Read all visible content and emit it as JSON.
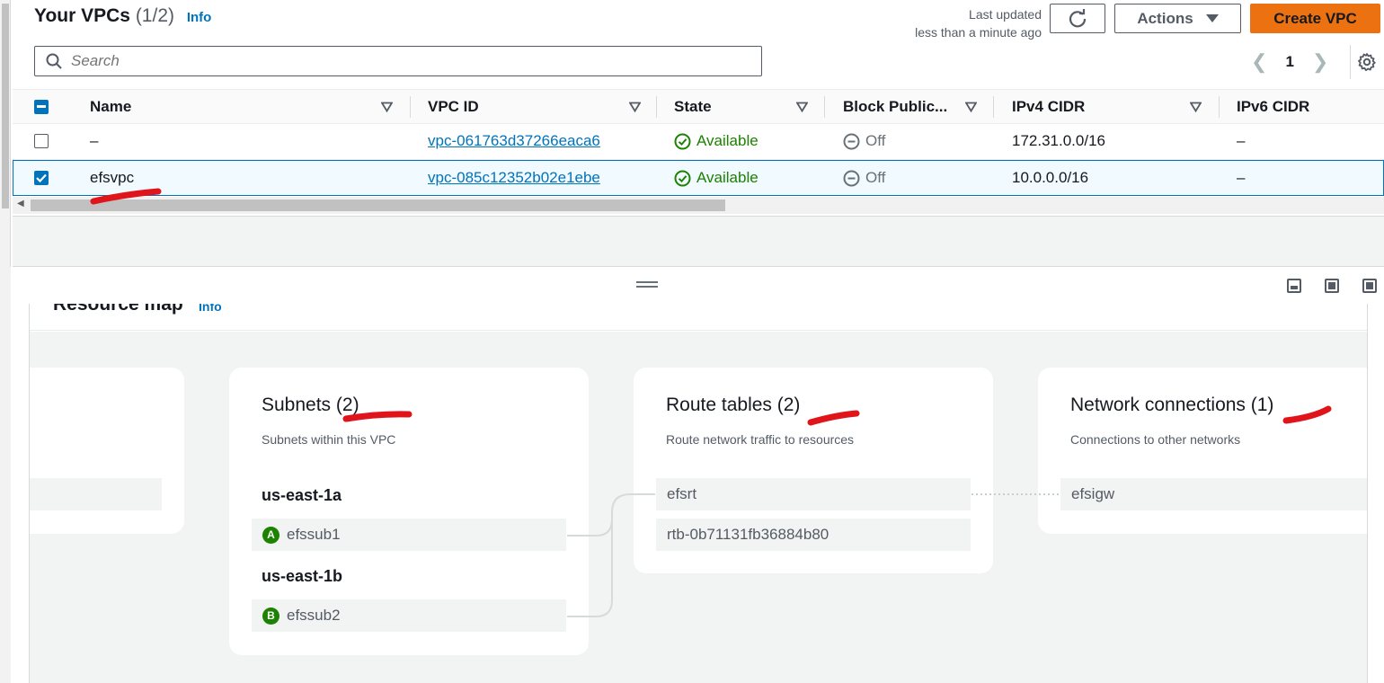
{
  "header": {
    "title": "Your VPCs",
    "count": "(1/2)",
    "info": "Info",
    "last_updated_line1": "Last updated",
    "last_updated_line2": "less than a minute ago",
    "actions_label": "Actions",
    "create_label": "Create VPC"
  },
  "search": {
    "placeholder": "Search"
  },
  "pagination": {
    "page": "1"
  },
  "table": {
    "columns": [
      "Name",
      "VPC ID",
      "State",
      "Block Public...",
      "IPv4 CIDR",
      "IPv6 CIDR"
    ],
    "rows": [
      {
        "name": "–",
        "vpc_id": "vpc-061763d37266eaca6",
        "state": "Available",
        "block": "Off",
        "ipv4": "172.31.0.0/16",
        "ipv6": "–",
        "selected": false
      },
      {
        "name": "efsvpc",
        "vpc_id": "vpc-085c12352b02e1ebe",
        "state": "Available",
        "block": "Off",
        "ipv4": "10.0.0.0/16",
        "ipv6": "–",
        "selected": true
      }
    ]
  },
  "resource_map": {
    "title": "Resource map",
    "info": "Info",
    "subnets": {
      "title": "Subnets (2)",
      "subtitle": "Subnets within this VPC",
      "zones": [
        {
          "az": "us-east-1a",
          "badge": "A",
          "subnet": "efssub1"
        },
        {
          "az": "us-east-1b",
          "badge": "B",
          "subnet": "efssub2"
        }
      ]
    },
    "route_tables": {
      "title": "Route tables (2)",
      "subtitle": "Route network traffic to resources",
      "items": [
        "efsrt",
        "rtb-0b71131fb36884b80"
      ]
    },
    "network_connections": {
      "title": "Network connections (1)",
      "subtitle": "Connections to other networks",
      "items": [
        "efsigw"
      ]
    }
  },
  "colors": {
    "accent": "#0073bb",
    "primary_button": "#ec7211",
    "available": "#1d8102",
    "annotation": "#e0141b"
  }
}
